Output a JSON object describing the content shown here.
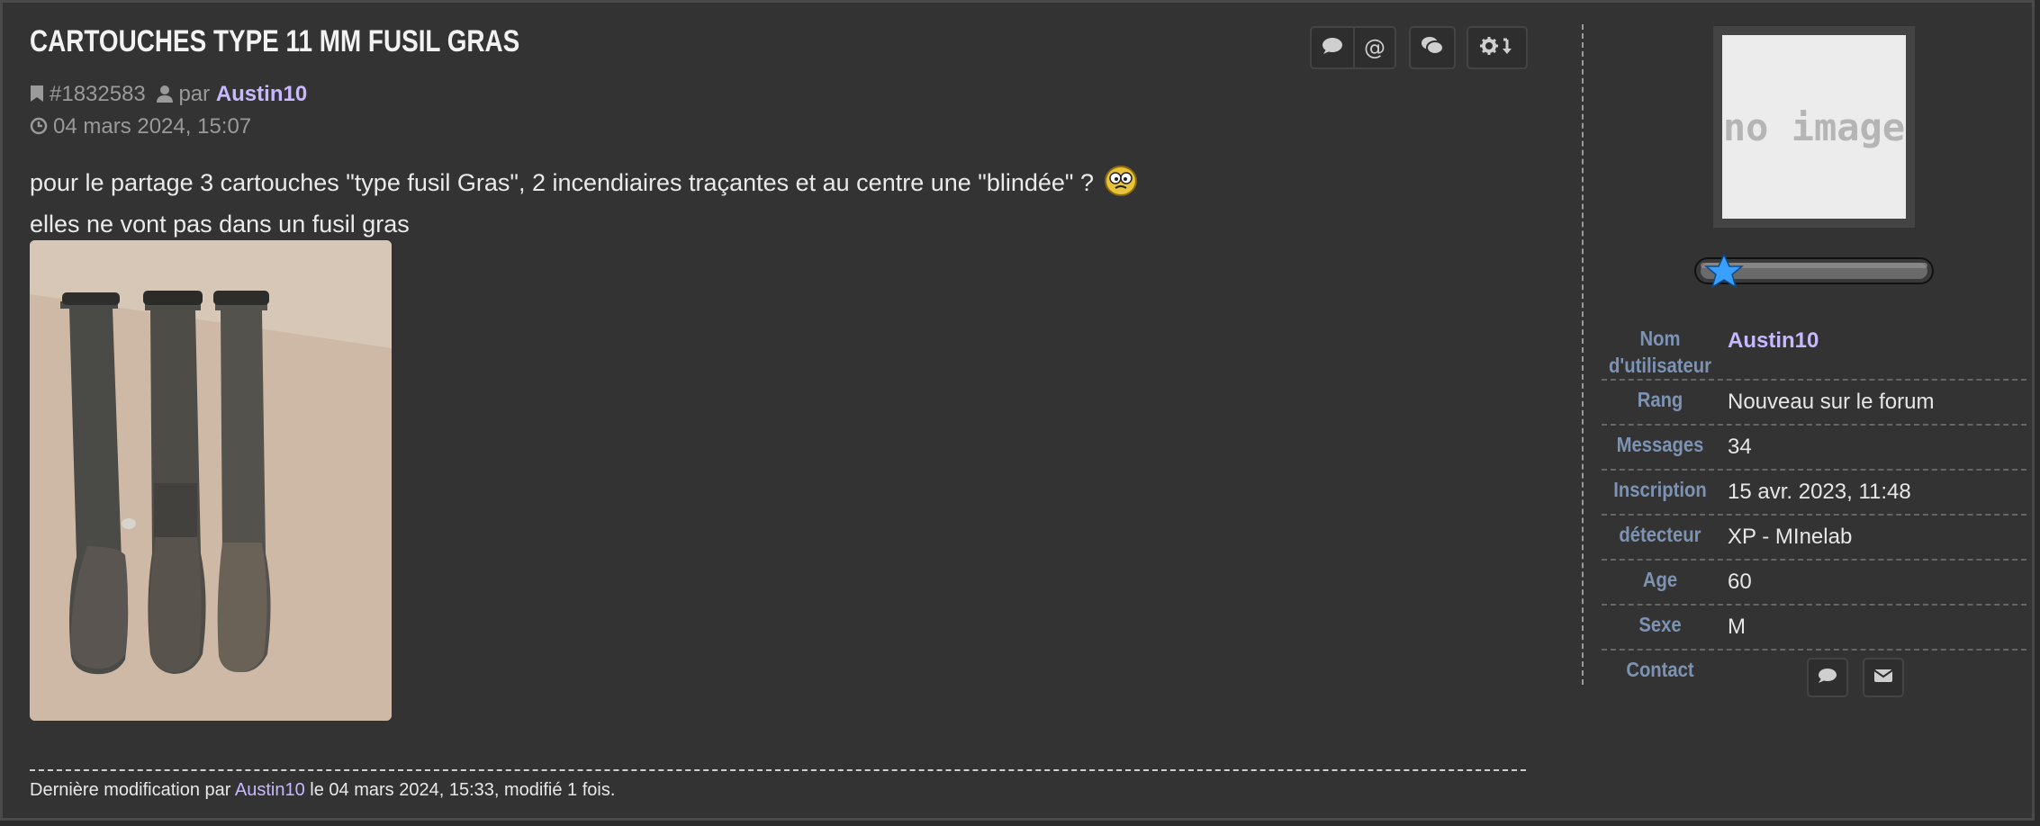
{
  "post": {
    "title": "Cartouches type 11 mm fusil Gras",
    "post_id": "#1832583",
    "by_label": "par",
    "author": "Austin10",
    "date": "04 mars 2024, 15:07",
    "body_line1": "pour le partage 3 cartouches \"type fusil Gras\", 2 incendiaires traçantes et au centre une \"blindée\" ?",
    "body_line2": "elles ne vont pas dans un fusil gras",
    "edit_prefix": "Dernière modification par",
    "edit_author": "Austin10",
    "edit_suffix": "le 04 mars 2024, 15:33, modifié 1 fois."
  },
  "actions": {
    "icons": [
      "comment-icon",
      "at-icon",
      "quote-icon",
      "gear-icon"
    ]
  },
  "profile": {
    "avatar_text": "no image",
    "rank_stars": 1,
    "rows": [
      {
        "label": "Nom d'utilisateur",
        "value": "Austin10"
      },
      {
        "label": "Rang",
        "value": "Nouveau sur le forum"
      },
      {
        "label": "Messages",
        "value": "34"
      },
      {
        "label": "Inscription",
        "value": "15 avr. 2023, 11:48"
      },
      {
        "label": "détecteur",
        "value": "XP - MInelab"
      },
      {
        "label": "Age",
        "value": "60"
      },
      {
        "label": "Sexe",
        "value": "M"
      },
      {
        "label": "Contact",
        "value": ""
      }
    ]
  },
  "colors": {
    "background": "#333333",
    "link": "#c8b8ff",
    "label": "#7d93b4"
  }
}
